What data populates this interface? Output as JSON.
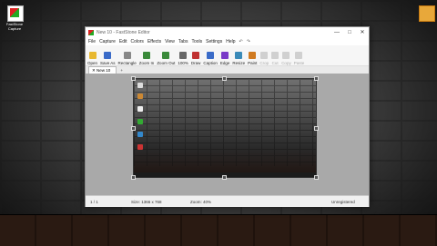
{
  "desktop": {
    "left_icon_label": "FastStone Capture",
    "left_icon_name": "faststone-icon",
    "right_icon_name": "folder-icon"
  },
  "window": {
    "title": "New 10 - FastStone Editor",
    "controls": {
      "minimize": "—",
      "maximize": "□",
      "close": "✕"
    }
  },
  "menu": [
    "File",
    "Capture",
    "Edit",
    "Colors",
    "Effects",
    "View",
    "Tabs",
    "Tools",
    "Settings",
    "Help"
  ],
  "quick_actions": [
    "↶",
    "↷"
  ],
  "toolbar": [
    {
      "label": "Open",
      "icon": "folder-open-icon",
      "color": "#e8b830",
      "enabled": true
    },
    {
      "label": "Save As",
      "icon": "save-icon",
      "color": "#3a6bc8",
      "enabled": true
    },
    {
      "label": "Rectangle",
      "icon": "rectangle-select-icon",
      "color": "#888888",
      "enabled": true
    },
    {
      "label": "Zoom In",
      "icon": "zoom-in-icon",
      "color": "#3a8a3a",
      "enabled": true
    },
    {
      "label": "Zoom Out",
      "icon": "zoom-out-icon",
      "color": "#3a8a3a",
      "enabled": true
    },
    {
      "label": "100%",
      "icon": "actual-size-icon",
      "color": "#666666",
      "enabled": true
    },
    {
      "label": "Draw",
      "icon": "draw-icon",
      "color": "#c03030",
      "enabled": true
    },
    {
      "label": "Caption",
      "icon": "caption-icon",
      "color": "#3a6bc8",
      "enabled": true
    },
    {
      "label": "Edge",
      "icon": "edge-icon",
      "color": "#7a3ac8",
      "enabled": true
    },
    {
      "label": "Resize",
      "icon": "resize-icon",
      "color": "#3a8ab8",
      "enabled": true
    },
    {
      "label": "Paint",
      "icon": "paint-icon",
      "color": "#d07a20",
      "enabled": true
    },
    {
      "label": "Crop",
      "icon": "crop-icon",
      "color": "#999999",
      "enabled": false
    },
    {
      "label": "Cut",
      "icon": "cut-icon",
      "color": "#999999",
      "enabled": false
    },
    {
      "label": "Copy",
      "icon": "copy-icon",
      "color": "#999999",
      "enabled": false
    },
    {
      "label": "Paste",
      "icon": "paste-icon",
      "color": "#999999",
      "enabled": false
    }
  ],
  "tabs": [
    {
      "label": "New 10",
      "close": "✕"
    }
  ],
  "tab_new": "+",
  "status": {
    "page": "1 / 1",
    "size": "Size: 1366 x 768",
    "zoom": "Zoom: 40%",
    "state": "Unregistered"
  }
}
